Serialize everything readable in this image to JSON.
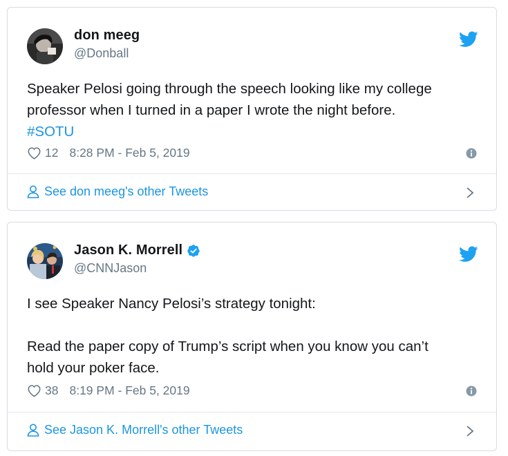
{
  "tweets": [
    {
      "display_name": "don meeg",
      "handle": "@Donball",
      "verified": false,
      "text_line1": "Speaker Pelosi going through the speech looking like my college",
      "text_line2": "professor when I turned in a paper I wrote the night before.",
      "hashtag": "#SOTU",
      "likes": "12",
      "timestamp": "8:28 PM - Feb 5, 2019",
      "footer_link": "See don meeg's other Tweets",
      "avatar_icon": "user-avatar-photo"
    },
    {
      "display_name": "Jason K. Morrell",
      "handle": "@CNNJason",
      "verified": true,
      "text_line1": "I see Speaker Nancy Pelosi’s strategy tonight:",
      "text_line2": "Read the paper copy of Trump’s script when you know you can’t",
      "text_line3": "hold your poker face.",
      "likes": "38",
      "timestamp": "8:19 PM - Feb 5, 2019",
      "footer_link": "See Jason K. Morrell's other Tweets",
      "avatar_icon": "user-avatar-photo"
    }
  ],
  "colors": {
    "twitter_blue": "#1da1f2",
    "link_blue": "#1b95e0",
    "muted_gray": "#657786",
    "border": "#d7dde2"
  },
  "icons": {
    "brand": "twitter-bird-icon",
    "like": "heart-outline-icon",
    "info": "info-circle-icon",
    "profile": "person-outline-icon",
    "more": "chevron-right-icon",
    "verified": "verified-badge-icon"
  }
}
